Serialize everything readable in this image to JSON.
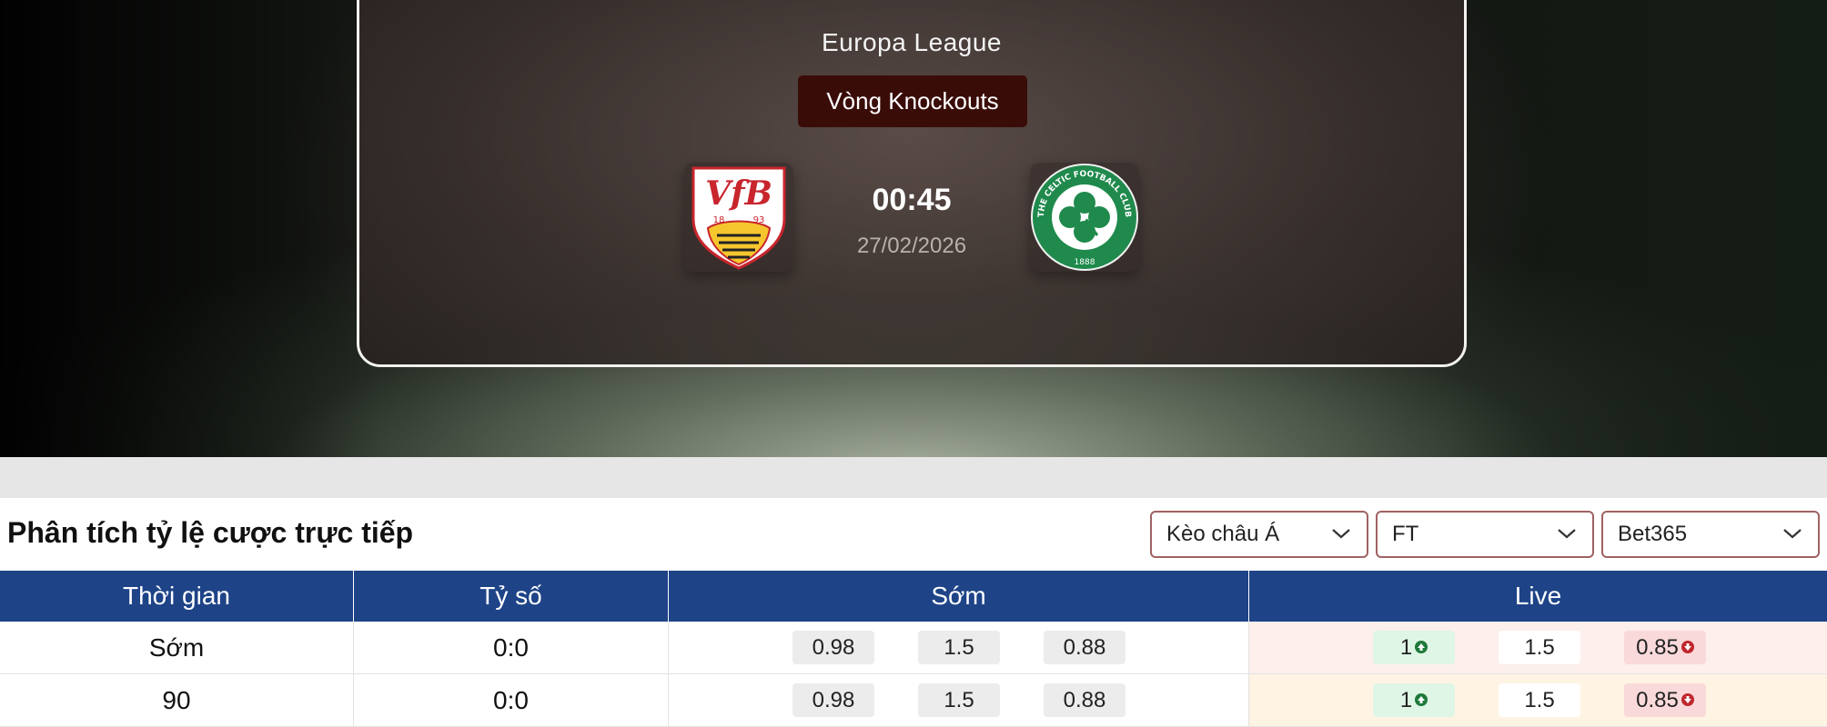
{
  "match": {
    "competition": "Europa League",
    "round": "Vòng Knockouts",
    "kickoff_time": "00:45",
    "date": "27/02/2026",
    "home_team": {
      "logo_icon": "vfb-stuttgart-crest-icon",
      "logo_text": "VfB",
      "logo_years": [
        "18",
        "93"
      ]
    },
    "away_team": {
      "logo_icon": "celtic-fc-crest-icon",
      "logo_ring_text": "THE CELTIC FOOTBALL CLUB",
      "logo_year": "1888"
    }
  },
  "odds_section": {
    "title": "Phân tích tỷ lệ cược trực tiếp",
    "filters": [
      {
        "value": "Kèo châu Á"
      },
      {
        "value": "FT"
      },
      {
        "value": "Bet365"
      }
    ],
    "columns": [
      "Thời gian",
      "Tỷ số",
      "Sớm",
      "Live"
    ],
    "rows": [
      {
        "time": "Sớm",
        "score": "0:0",
        "early": [
          "0.98",
          "1.5",
          "0.88"
        ],
        "live": [
          "1",
          "1.5",
          "0.85"
        ]
      },
      {
        "time": "90",
        "score": "0:0",
        "early": [
          "0.98",
          "1.5",
          "0.88"
        ],
        "live": [
          "1",
          "1.5",
          "0.85"
        ]
      }
    ]
  },
  "colors": {
    "table_header": "#1e4387",
    "round_badge": "#3a0c08",
    "odds_up": "#1f7a3a",
    "odds_down": "#c0272d",
    "dropdown_border": "#a06262"
  }
}
